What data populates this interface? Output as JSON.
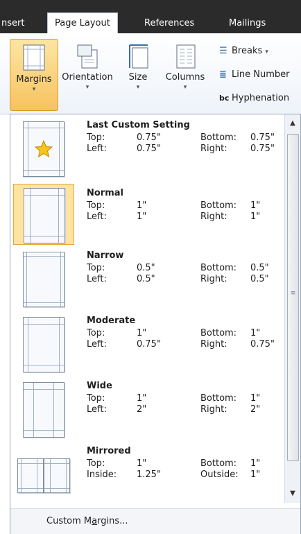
{
  "tabs": [
    {
      "label": "nsert"
    },
    {
      "label": "Page Layout"
    },
    {
      "label": "References"
    },
    {
      "label": "Mailings"
    }
  ],
  "ribbon": {
    "margins": "Margins",
    "orientation": "Orientation",
    "size": "Size",
    "columns": "Columns",
    "breaks": "Breaks",
    "line_numbers": "Line Number",
    "hyphenation": "Hyphenation",
    "hyphen_icon": "bc"
  },
  "margin_presets": [
    {
      "name": "Last Custom Setting",
      "k1": "Top:",
      "v1": "0.75\"",
      "k2": "Bottom:",
      "v2": "0.75\"",
      "k3": "Left:",
      "v3": "0.75\"",
      "k4": "Right:",
      "v4": "0.75\""
    },
    {
      "name": "Normal",
      "k1": "Top:",
      "v1": "1\"",
      "k2": "Bottom:",
      "v2": "1\"",
      "k3": "Left:",
      "v3": "1\"",
      "k4": "Right:",
      "v4": "1\""
    },
    {
      "name": "Narrow",
      "k1": "Top:",
      "v1": "0.5\"",
      "k2": "Bottom:",
      "v2": "0.5\"",
      "k3": "Left:",
      "v3": "0.5\"",
      "k4": "Right:",
      "v4": "0.5\""
    },
    {
      "name": "Moderate",
      "k1": "Top:",
      "v1": "1\"",
      "k2": "Bottom:",
      "v2": "1\"",
      "k3": "Left:",
      "v3": "0.75\"",
      "k4": "Right:",
      "v4": "0.75\""
    },
    {
      "name": "Wide",
      "k1": "Top:",
      "v1": "1\"",
      "k2": "Bottom:",
      "v2": "1\"",
      "k3": "Left:",
      "v3": "2\"",
      "k4": "Right:",
      "v4": "2\""
    },
    {
      "name": "Mirrored",
      "k1": "Top:",
      "v1": "1\"",
      "k2": "Bottom:",
      "v2": "1\"",
      "k3": "Inside:",
      "v3": "1.25\"",
      "k4": "Outside:",
      "v4": "1\""
    }
  ],
  "selected_preset": "Normal",
  "custom_margins": {
    "pre": "Custom M",
    "underline": "a",
    "post": "rgins..."
  },
  "colors": {
    "accent": "#f7c25e",
    "selected": "#fde4a0",
    "tab_bar": "#2b2b2b"
  }
}
